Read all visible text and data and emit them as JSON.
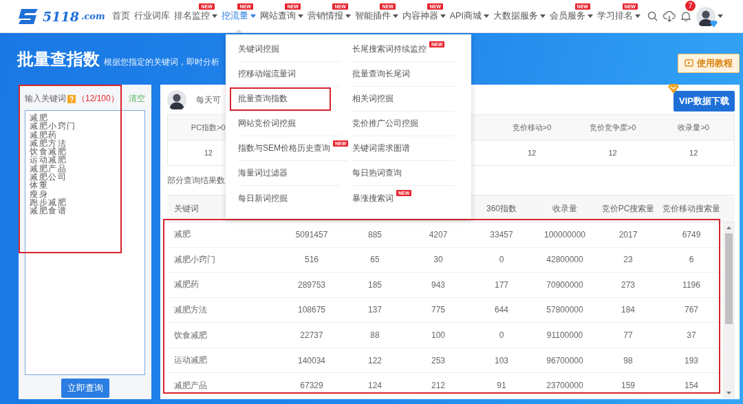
{
  "logo": {
    "main": "5118",
    "suffix": ".com"
  },
  "nav": [
    {
      "label": "首页",
      "has_menu": false,
      "selected": false
    },
    {
      "label": "行业词库",
      "has_menu": false,
      "selected": false
    },
    {
      "label": "排名监控",
      "has_menu": true,
      "badge": "NEW",
      "selected": false
    },
    {
      "label": "挖流量",
      "has_menu": true,
      "badge": "NEW",
      "selected": true
    },
    {
      "label": "网站查询",
      "has_menu": true,
      "badge": "NEW",
      "selected": false
    },
    {
      "label": "营销情报",
      "has_menu": true,
      "badge": "NEW",
      "selected": false
    },
    {
      "label": "智能插件",
      "has_menu": true,
      "badge": "NEW",
      "selected": false
    },
    {
      "label": "内容神器",
      "has_menu": true,
      "badge": "NEW",
      "selected": false
    },
    {
      "label": "API商城",
      "has_menu": true,
      "selected": false
    },
    {
      "label": "大数据服务",
      "has_menu": true,
      "selected": false
    },
    {
      "label": "会员服务",
      "has_menu": true,
      "badge": "NEW",
      "selected": false
    },
    {
      "label": "学习排名",
      "has_menu": true,
      "badge": "NEW",
      "selected": false
    }
  ],
  "notifications": {
    "count": "7"
  },
  "page": {
    "title": "批量查指数",
    "subtitle": "根据您指定的关键词，即时分析",
    "tutorial_button": "使用教程"
  },
  "keyword_panel": {
    "label": "输入关键词",
    "count": "（12/100）",
    "clear": "清空",
    "highlighted": true,
    "keywords": [
      "减肥",
      "减肥小窍门",
      "减肥药",
      "减肥方法",
      "饮食减肥",
      "运动减肥",
      "减肥产品",
      "减肥公司",
      "体重",
      "瘦身",
      "跑步减肥",
      "减肥食谱"
    ],
    "submit": "立即查询"
  },
  "results": {
    "notice": "每天可",
    "vip_button": "VIP数据下载",
    "stats": [
      {
        "kind": "stat",
        "label": "PC指数>0",
        "value": "12"
      },
      {
        "kind": "covered"
      },
      {
        "kind": "covered"
      },
      {
        "kind": "covered"
      },
      {
        "kind": "stat",
        "label": "竞价移动>0",
        "value": "12"
      },
      {
        "kind": "stat",
        "label": "竞价竞争度>0",
        "value": "12"
      },
      {
        "kind": "stat",
        "label": "收录量>0",
        "value": "12"
      }
    ],
    "section_label": "部分查询结果数",
    "table": {
      "highlighted": true,
      "columns": [
        {
          "kind": "header",
          "label": "关键词"
        },
        {
          "kind": "covered"
        },
        {
          "kind": "covered"
        },
        {
          "kind": "covered"
        },
        {
          "kind": "header",
          "label": "360指数"
        },
        {
          "kind": "header",
          "label": "收录量"
        },
        {
          "kind": "header",
          "label": "竞价PC搜索量"
        },
        {
          "kind": "header",
          "label": "竞价移动搜索量"
        }
      ],
      "rows": [
        [
          "减肥",
          "5091457",
          "885",
          "4207",
          "33457",
          "100000000",
          "2017",
          "6749"
        ],
        [
          "减肥小窍门",
          "516",
          "65",
          "30",
          "0",
          "42800000",
          "23",
          "6"
        ],
        [
          "减肥药",
          "289753",
          "185",
          "943",
          "177",
          "70900000",
          "273",
          "1196"
        ],
        [
          "减肥方法",
          "108675",
          "137",
          "775",
          "644",
          "57800000",
          "184",
          "767"
        ],
        [
          "饮食减肥",
          "22737",
          "88",
          "100",
          "0",
          "91100000",
          "77",
          "37"
        ],
        [
          "运动减肥",
          "140034",
          "122",
          "253",
          "103",
          "96700000",
          "98",
          "193"
        ],
        [
          "减肥产品",
          "67329",
          "124",
          "212",
          "91",
          "23700000",
          "159",
          "154"
        ]
      ]
    }
  },
  "dropdown_menu": {
    "columns": [
      [
        {
          "label": "关键词挖掘",
          "highlighted": false
        },
        {
          "label": "挖移动端流量词",
          "highlighted": false
        },
        {
          "label": "批量查询指数",
          "highlighted": true
        },
        {
          "label": "网站竞价词挖掘",
          "highlighted": false
        },
        {
          "label": "指数与SEM价格历史查询",
          "badge": "NEW",
          "highlighted": false
        },
        {
          "label": "海量词过滤器",
          "highlighted": false
        },
        {
          "label": "每日新词挖掘",
          "highlighted": false
        }
      ],
      [
        {
          "label": "长尾搜索词持续监控",
          "badge": "NEW",
          "highlighted": false
        },
        {
          "label": "批量查询长尾词",
          "highlighted": false
        },
        {
          "label": "相关词挖掘",
          "highlighted": false
        },
        {
          "label": "竞价推广公司挖掘",
          "highlighted": false
        },
        {
          "label": "关键词需求图谱",
          "highlighted": false
        },
        {
          "label": "每日热词查询",
          "highlighted": false
        },
        {
          "label": "暴涨搜索词",
          "badge": "NEW",
          "highlighted": false
        }
      ]
    ]
  }
}
